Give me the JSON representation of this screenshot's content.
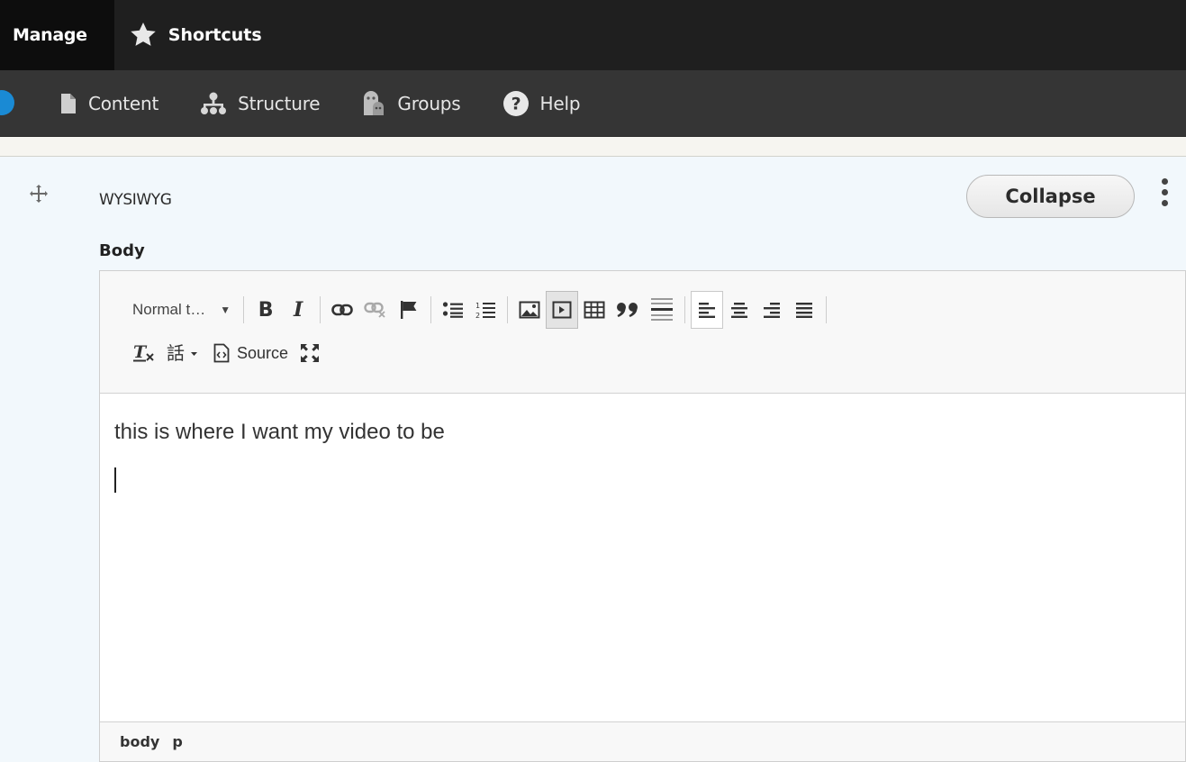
{
  "admin_toolbar": {
    "tabs": [
      {
        "label": "Manage"
      },
      {
        "label": "Shortcuts",
        "icon": "star-icon"
      }
    ],
    "tray_items": [
      {
        "label": "Content",
        "icon": "file-icon"
      },
      {
        "label": "Structure",
        "icon": "sitemap-icon"
      },
      {
        "label": "Groups",
        "icon": "groups-icon"
      },
      {
        "label": "Help",
        "icon": "help-icon"
      }
    ]
  },
  "paragraph": {
    "type_label": "WYSIWYG",
    "collapse_label": "Collapse",
    "field_label": "Body"
  },
  "editor": {
    "format_select": "Normal t…",
    "toolbar_buttons": [
      "bold-icon",
      "italic-icon",
      "link-icon",
      "unlink-icon",
      "anchor-icon",
      "bulleted-list-icon",
      "numbered-list-icon",
      "image-icon",
      "video-embed-icon",
      "table-icon",
      "blockquote-icon",
      "horizontal-rule-icon",
      "align-left-icon",
      "align-center-icon",
      "align-right-icon",
      "justify-icon",
      "remove-format-icon",
      "language-icon",
      "source-icon",
      "maximize-icon"
    ],
    "source_label": "Source",
    "content_text": "this is where I want my video to be",
    "elements_path": [
      "body",
      "p"
    ]
  },
  "colors": {
    "toolbar_bg": "#1f1f1f",
    "tray_bg": "#353535",
    "row_bg": "#f2f8fc"
  }
}
